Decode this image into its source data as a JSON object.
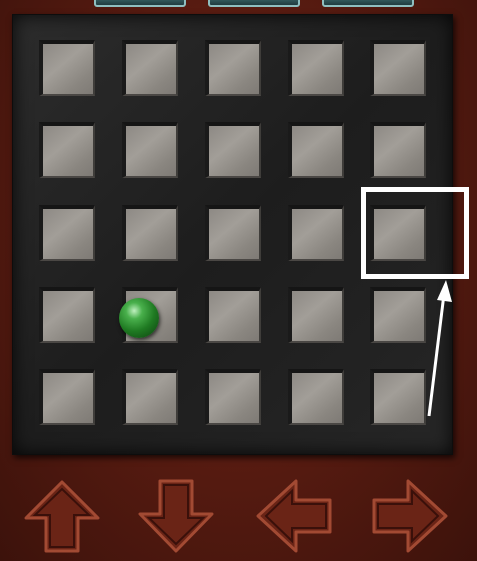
{
  "game": {
    "grid_rows": 5,
    "grid_cols": 5,
    "ball": {
      "color": "#2e9a33",
      "row": 4,
      "col": 2
    },
    "highlight": {
      "row": 3,
      "col": 5,
      "color": "#ffffff"
    },
    "hint_arrow": {
      "color": "#ffffff",
      "direction": "up"
    }
  },
  "controls": [
    {
      "icon": "arrow-up-icon"
    },
    {
      "icon": "arrow-down-icon"
    },
    {
      "icon": "arrow-left-icon"
    },
    {
      "icon": "arrow-right-icon"
    }
  ],
  "colors": {
    "background": "#5a1c12",
    "board": "#232323",
    "cell": "#96928c",
    "button_fill": "#6a2416",
    "button_outline": "#a24a33"
  }
}
